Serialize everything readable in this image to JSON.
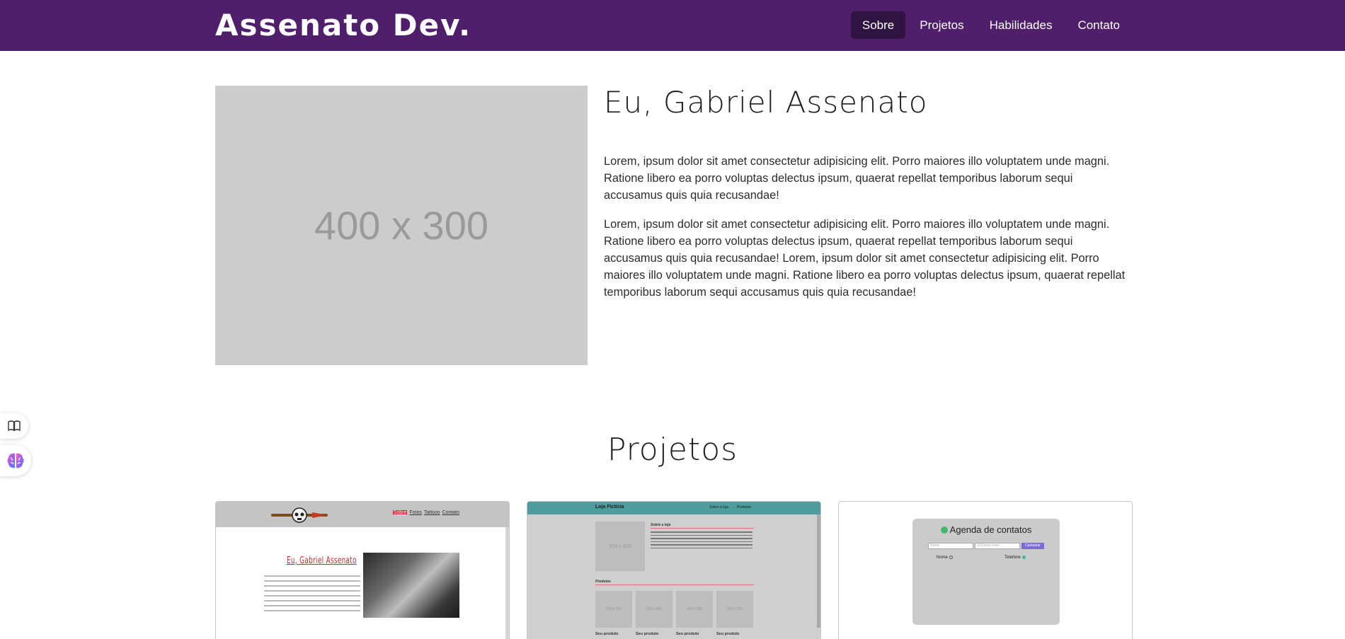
{
  "navbar": {
    "brand": "Assenato Dev.",
    "links": [
      {
        "label": "Sobre",
        "active": true
      },
      {
        "label": "Projetos",
        "active": false
      },
      {
        "label": "Habilidades",
        "active": false
      },
      {
        "label": "Contato",
        "active": false
      }
    ]
  },
  "about": {
    "image_placeholder": "400 x 300",
    "title": "Eu, Gabriel Assenato",
    "paragraphs": [
      "Lorem, ipsum dolor sit amet consectetur adipisicing elit. Porro maiores illo voluptatem unde magni. Ratione libero ea porro voluptas delectus ipsum, quaerat repellat temporibus laborum sequi accusamus quis quia recusandae!",
      "Lorem, ipsum dolor sit amet consectetur adipisicing elit. Porro maiores illo voluptatem unde magni. Ratione libero ea porro voluptas delectus ipsum, quaerat repellat temporibus laborum sequi accusamus quis quia recusandae! Lorem, ipsum dolor sit amet consectetur adipisicing elit. Porro maiores illo voluptatem unde magni. Ratione libero ea porro voluptas delectus ipsum, quaerat repellat temporibus laborum sequi accusamus quis quia recusandae!"
    ]
  },
  "side_widgets": [
    {
      "icon": "book-icon"
    },
    {
      "icon": "brain-icon"
    }
  ],
  "projects": {
    "title": "Projetos",
    "cards": [
      {
        "menu": [
          "Sobre",
          "Fotos",
          "Tattoos",
          "Contato"
        ],
        "heading": "Eu, Gabriel Assenato"
      },
      {
        "brand": "Loja Fictícia",
        "links": [
          "Sobre a loja",
          "Produtos"
        ],
        "image_placeholder": "320 x 320",
        "about_heading": "Sobre a loja",
        "products_heading": "Produtos",
        "product_placeholder": "200 x 200",
        "product_caption": "Seu produto"
      },
      {
        "title": "Agenda de contatos",
        "name_placeholder": "Nome",
        "phone_placeholder": "(XX)xxxx-xxxx",
        "button": "Cadastrar",
        "col_name": "Nome",
        "col_phone": "Telefone"
      }
    ]
  },
  "colors": {
    "navbar_bg": "#4f1f6b",
    "nav_active_bg": "#2f1340",
    "placeholder_bg": "#cccccc"
  }
}
